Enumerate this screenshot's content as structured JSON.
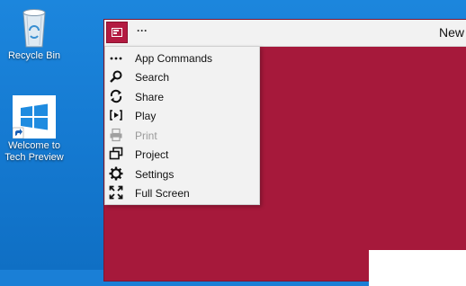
{
  "desktop": {
    "icons": [
      {
        "label": "Recycle Bin",
        "icon": "recycle-bin-icon"
      },
      {
        "label": "Welcome to Tech Preview",
        "label_line1": "Welcome to",
        "label_line2": "Tech Preview",
        "icon": "windows-shortcut-icon"
      }
    ]
  },
  "window": {
    "title": "New",
    "menu_button": "···",
    "accent_color": "#a6193b"
  },
  "menu": {
    "items": [
      {
        "label": "App Commands",
        "icon": "more-dots-icon",
        "enabled": true
      },
      {
        "label": "Search",
        "icon": "search-icon",
        "enabled": true
      },
      {
        "label": "Share",
        "icon": "share-icon",
        "enabled": true
      },
      {
        "label": "Play",
        "icon": "play-icon",
        "enabled": true
      },
      {
        "label": "Print",
        "icon": "print-icon",
        "enabled": false
      },
      {
        "label": "Project",
        "icon": "project-icon",
        "enabled": true
      },
      {
        "label": "Settings",
        "icon": "settings-gear-icon",
        "enabled": true
      },
      {
        "label": "Full Screen",
        "icon": "full-screen-icon",
        "enabled": true
      }
    ]
  }
}
